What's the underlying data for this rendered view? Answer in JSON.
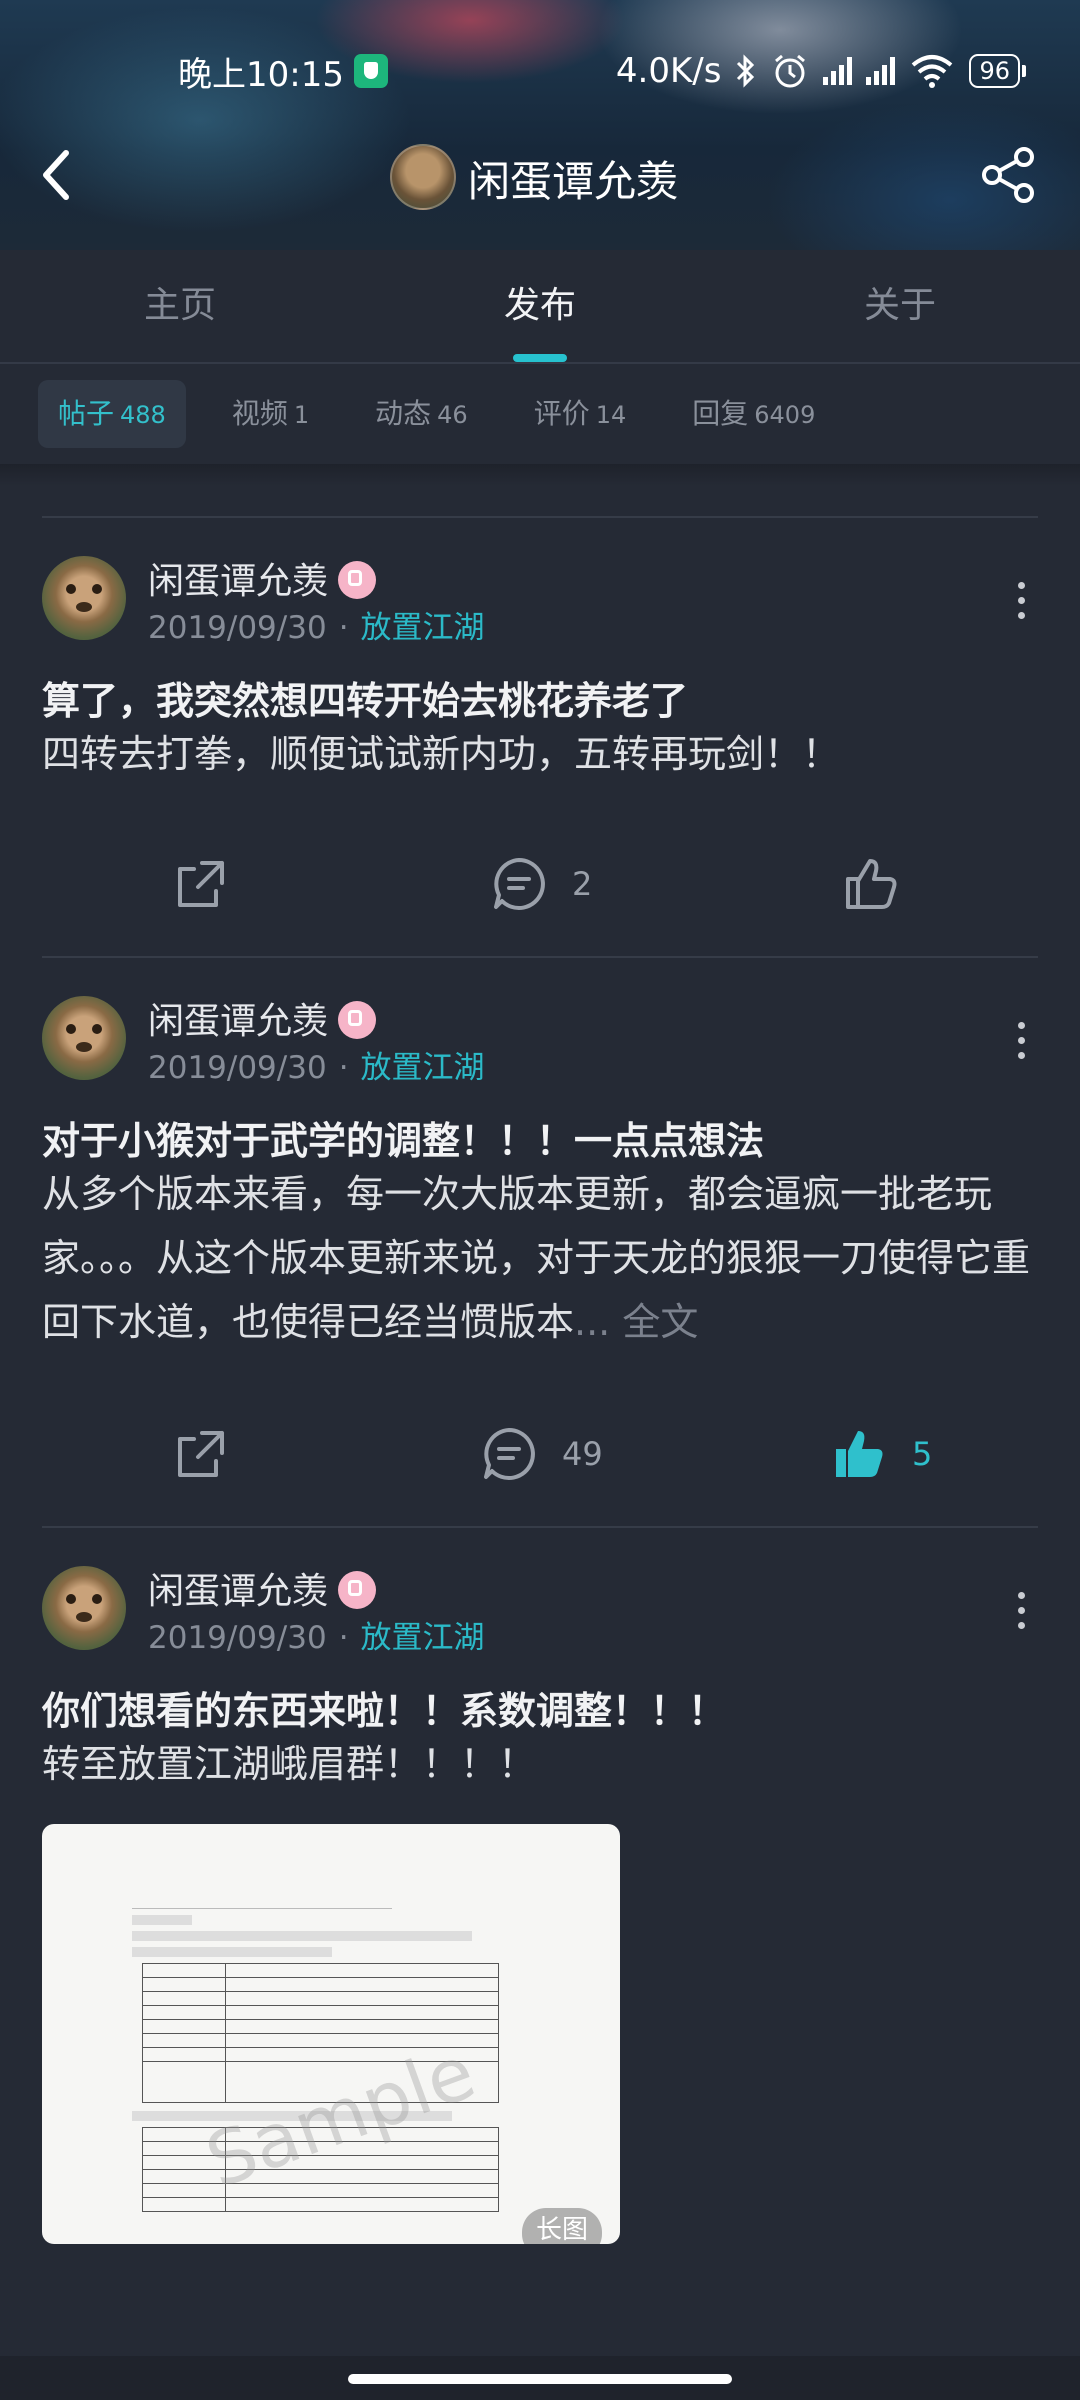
{
  "status_bar": {
    "time": "晚上10:15",
    "speed": "4.0K/s",
    "battery": "96"
  },
  "header": {
    "username": "闲蛋谭允羡"
  },
  "tabs": [
    {
      "label": "主页"
    },
    {
      "label": "发布"
    },
    {
      "label": "关于"
    }
  ],
  "subtabs": [
    {
      "label": "帖子",
      "count": "488"
    },
    {
      "label": "视频",
      "count": "1"
    },
    {
      "label": "动态",
      "count": "46"
    },
    {
      "label": "评价",
      "count": "14"
    },
    {
      "label": "回复",
      "count": "6409"
    }
  ],
  "posts": [
    {
      "author": "闲蛋谭允羡",
      "date": "2019/09/30",
      "separator": "·",
      "forum": "放置江湖",
      "title": "算了，我突然想四转开始去桃花养老了",
      "body": "四转去打拳，顺便试试新内功，五转再玩剑！！",
      "comments": "2",
      "likes": ""
    },
    {
      "author": "闲蛋谭允羡",
      "date": "2019/09/30",
      "separator": "·",
      "forum": "放置江湖",
      "title": "对于小猴对于武学的调整！！！一点点想法",
      "body": "从多个版本来看，每一次大版本更新，都会逼疯一批老玩家。。。从这个版本更新来说，对于天龙的狠狠一刀使得它重回下水道，也使得已经当惯版本",
      "full_text_link": "... 全文",
      "comments": "49",
      "likes": "5"
    },
    {
      "author": "闲蛋谭允羡",
      "date": "2019/09/30",
      "separator": "·",
      "forum": "放置江湖",
      "title": "你们想看的东西来啦！！系数调整！！！",
      "body": "转至放置江湖峨眉群！！！！",
      "image_badge": "长图",
      "image_watermark": "Sample"
    }
  ],
  "colors": {
    "background": "#252a35",
    "accent": "#27c2cf",
    "liked": "#2fc0cc"
  }
}
